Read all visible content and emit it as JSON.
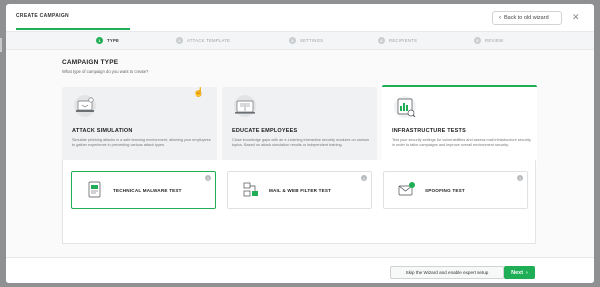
{
  "header": {
    "title": "CREATE CAMPAIGN",
    "back_label": "Back to old wizard",
    "close_glyph": "✕"
  },
  "steps": [
    {
      "num": "1",
      "label": "TYPE",
      "active": true
    },
    {
      "num": "2",
      "label": "ATTACK TEMPLATE"
    },
    {
      "num": "3",
      "label": "SETTINGS"
    },
    {
      "num": "4",
      "label": "RECIPIENTS"
    },
    {
      "num": "5",
      "label": "REVIEW"
    }
  ],
  "section": {
    "title": "CAMPAIGN TYPE",
    "subtitle": "What type of campaign do you want to create?"
  },
  "cards": [
    {
      "title": "ATTACK SIMULATION",
      "desc": "Simulate phishing attacks in a safe learning environment, allowing your employees to gather experience in preventing various attack types.",
      "icon": "phishing-laptop-icon"
    },
    {
      "title": "EDUCATE EMPLOYEES",
      "desc": "Close knowledge gaps with an e-Learning interactive security modules on various topics. Based on attack simulation results or independent training.",
      "icon": "elearning-book-icon"
    },
    {
      "title": "INFRASTRUCTURE TESTS",
      "desc": "Test your security settings for vulnerabilities and assess mail infrastructure security in order to tailor campaigns and improve overall environment security.",
      "icon": "infrastructure-chart-icon",
      "selected": true
    }
  ],
  "subtypes": [
    {
      "label": "TECHNICAL MALWARE TEST",
      "icon": "malware-document-icon",
      "selected": true
    },
    {
      "label": "MAIL & WEB FILTER TEST",
      "icon": "filter-network-icon"
    },
    {
      "label": "SPOOFING TEST",
      "icon": "spoofing-mail-icon"
    }
  ],
  "footer": {
    "skip_label": "Skip the Wizard and enable expert setup",
    "next_label": "Next"
  },
  "colors": {
    "accent": "#1fae55",
    "backdrop": "#8e9092"
  }
}
